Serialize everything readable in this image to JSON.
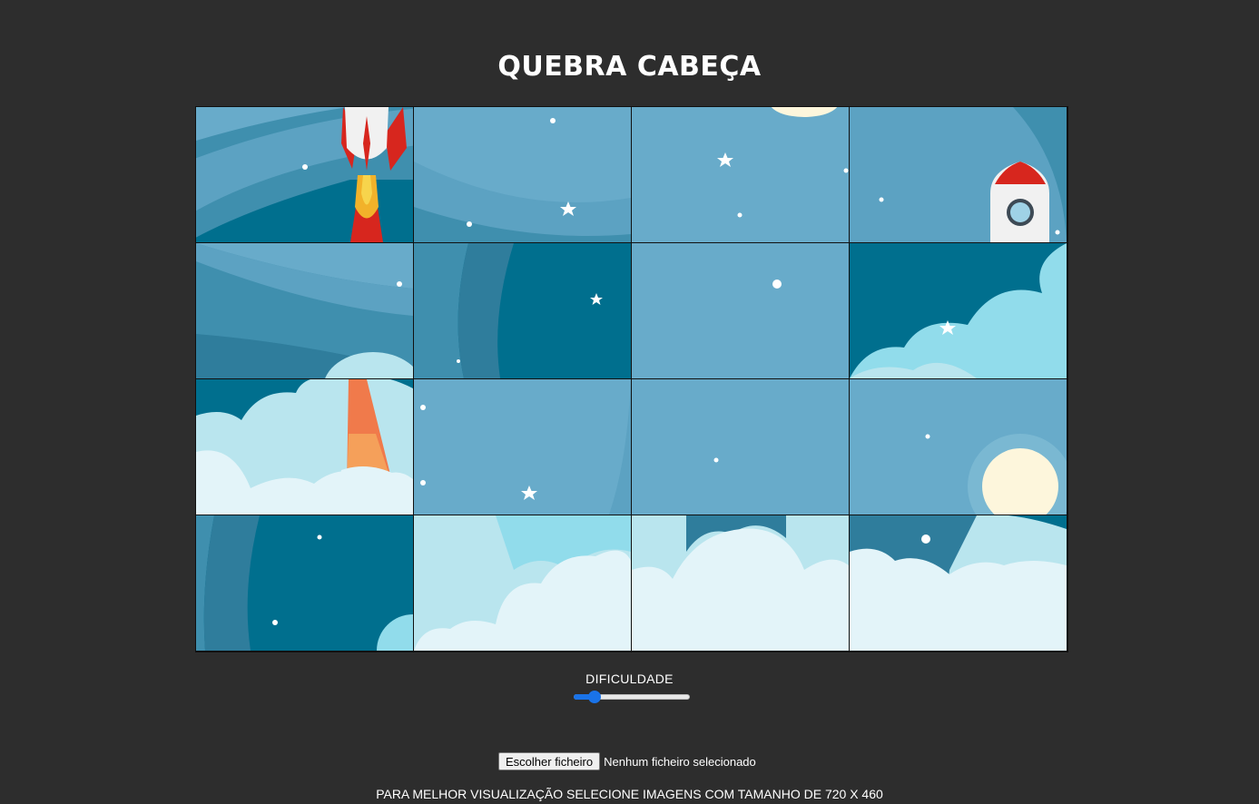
{
  "app": {
    "title": "QUEBRA CABEÇA"
  },
  "puzzle": {
    "rows": 4,
    "columns": 4,
    "image_subject": "cartoon rocket launching into a blue sky with clouds, stars and a sun",
    "tiles": [
      {
        "name": "tile-rocket-top"
      },
      {
        "name": "tile-sky-stars"
      },
      {
        "name": "tile-sky-sun-top"
      },
      {
        "name": "tile-rocket-window"
      },
      {
        "name": "tile-sky-curves"
      },
      {
        "name": "tile-sky-dark-star"
      },
      {
        "name": "tile-sky-plain"
      },
      {
        "name": "tile-sky-cloud-star"
      },
      {
        "name": "tile-rocket-exhaust-clouds"
      },
      {
        "name": "tile-sky-dots-star"
      },
      {
        "name": "tile-sky-dot"
      },
      {
        "name": "tile-sky-sun"
      },
      {
        "name": "tile-sky-dark-dots"
      },
      {
        "name": "tile-clouds-left"
      },
      {
        "name": "tile-clouds-middle"
      },
      {
        "name": "tile-clouds-right"
      }
    ]
  },
  "difficulty": {
    "label": "DIFICULDADE",
    "value_fraction": 0.14
  },
  "file_input": {
    "button_label": "Escolher ficheiro",
    "status": "Nenhum ficheiro selecionado"
  },
  "hint": "PARA MELHOR VISUALIZAÇÃO SELECIONE IMAGENS COM TAMANHO DE 720 X 460",
  "colors": {
    "background": "#2d2d2d",
    "sky_light": "#68abca",
    "sky_mid": "#3f8fae",
    "sky_dark": "#006f8e",
    "cloud_light": "#e3f4f9",
    "cloud_mid": "#b9e5ee",
    "sun": "#fdf6dc",
    "rocket_red": "#d7261e",
    "accent": "#1a73e8"
  }
}
